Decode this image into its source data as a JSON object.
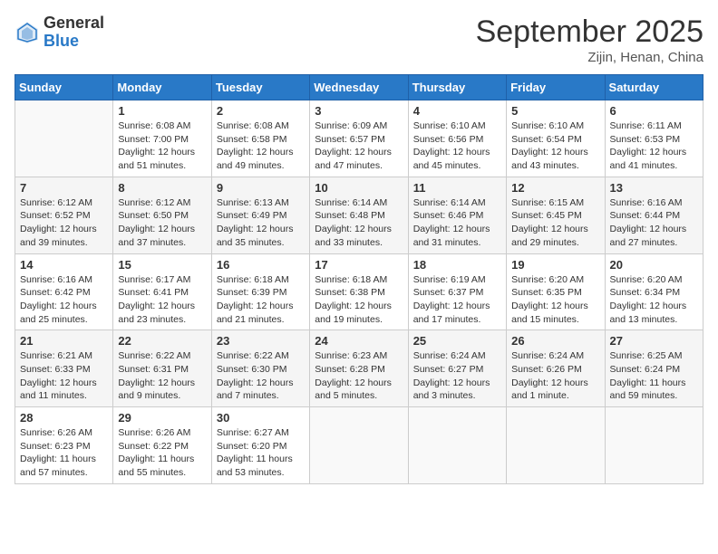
{
  "logo": {
    "general": "General",
    "blue": "Blue"
  },
  "title": "September 2025",
  "subtitle": "Zijin, Henan, China",
  "days_of_week": [
    "Sunday",
    "Monday",
    "Tuesday",
    "Wednesday",
    "Thursday",
    "Friday",
    "Saturday"
  ],
  "weeks": [
    [
      {
        "day": "",
        "info": ""
      },
      {
        "day": "1",
        "info": "Sunrise: 6:08 AM\nSunset: 7:00 PM\nDaylight: 12 hours and 51 minutes."
      },
      {
        "day": "2",
        "info": "Sunrise: 6:08 AM\nSunset: 6:58 PM\nDaylight: 12 hours and 49 minutes."
      },
      {
        "day": "3",
        "info": "Sunrise: 6:09 AM\nSunset: 6:57 PM\nDaylight: 12 hours and 47 minutes."
      },
      {
        "day": "4",
        "info": "Sunrise: 6:10 AM\nSunset: 6:56 PM\nDaylight: 12 hours and 45 minutes."
      },
      {
        "day": "5",
        "info": "Sunrise: 6:10 AM\nSunset: 6:54 PM\nDaylight: 12 hours and 43 minutes."
      },
      {
        "day": "6",
        "info": "Sunrise: 6:11 AM\nSunset: 6:53 PM\nDaylight: 12 hours and 41 minutes."
      }
    ],
    [
      {
        "day": "7",
        "info": "Sunrise: 6:12 AM\nSunset: 6:52 PM\nDaylight: 12 hours and 39 minutes."
      },
      {
        "day": "8",
        "info": "Sunrise: 6:12 AM\nSunset: 6:50 PM\nDaylight: 12 hours and 37 minutes."
      },
      {
        "day": "9",
        "info": "Sunrise: 6:13 AM\nSunset: 6:49 PM\nDaylight: 12 hours and 35 minutes."
      },
      {
        "day": "10",
        "info": "Sunrise: 6:14 AM\nSunset: 6:48 PM\nDaylight: 12 hours and 33 minutes."
      },
      {
        "day": "11",
        "info": "Sunrise: 6:14 AM\nSunset: 6:46 PM\nDaylight: 12 hours and 31 minutes."
      },
      {
        "day": "12",
        "info": "Sunrise: 6:15 AM\nSunset: 6:45 PM\nDaylight: 12 hours and 29 minutes."
      },
      {
        "day": "13",
        "info": "Sunrise: 6:16 AM\nSunset: 6:44 PM\nDaylight: 12 hours and 27 minutes."
      }
    ],
    [
      {
        "day": "14",
        "info": "Sunrise: 6:16 AM\nSunset: 6:42 PM\nDaylight: 12 hours and 25 minutes."
      },
      {
        "day": "15",
        "info": "Sunrise: 6:17 AM\nSunset: 6:41 PM\nDaylight: 12 hours and 23 minutes."
      },
      {
        "day": "16",
        "info": "Sunrise: 6:18 AM\nSunset: 6:39 PM\nDaylight: 12 hours and 21 minutes."
      },
      {
        "day": "17",
        "info": "Sunrise: 6:18 AM\nSunset: 6:38 PM\nDaylight: 12 hours and 19 minutes."
      },
      {
        "day": "18",
        "info": "Sunrise: 6:19 AM\nSunset: 6:37 PM\nDaylight: 12 hours and 17 minutes."
      },
      {
        "day": "19",
        "info": "Sunrise: 6:20 AM\nSunset: 6:35 PM\nDaylight: 12 hours and 15 minutes."
      },
      {
        "day": "20",
        "info": "Sunrise: 6:20 AM\nSunset: 6:34 PM\nDaylight: 12 hours and 13 minutes."
      }
    ],
    [
      {
        "day": "21",
        "info": "Sunrise: 6:21 AM\nSunset: 6:33 PM\nDaylight: 12 hours and 11 minutes."
      },
      {
        "day": "22",
        "info": "Sunrise: 6:22 AM\nSunset: 6:31 PM\nDaylight: 12 hours and 9 minutes."
      },
      {
        "day": "23",
        "info": "Sunrise: 6:22 AM\nSunset: 6:30 PM\nDaylight: 12 hours and 7 minutes."
      },
      {
        "day": "24",
        "info": "Sunrise: 6:23 AM\nSunset: 6:28 PM\nDaylight: 12 hours and 5 minutes."
      },
      {
        "day": "25",
        "info": "Sunrise: 6:24 AM\nSunset: 6:27 PM\nDaylight: 12 hours and 3 minutes."
      },
      {
        "day": "26",
        "info": "Sunrise: 6:24 AM\nSunset: 6:26 PM\nDaylight: 12 hours and 1 minute."
      },
      {
        "day": "27",
        "info": "Sunrise: 6:25 AM\nSunset: 6:24 PM\nDaylight: 11 hours and 59 minutes."
      }
    ],
    [
      {
        "day": "28",
        "info": "Sunrise: 6:26 AM\nSunset: 6:23 PM\nDaylight: 11 hours and 57 minutes."
      },
      {
        "day": "29",
        "info": "Sunrise: 6:26 AM\nSunset: 6:22 PM\nDaylight: 11 hours and 55 minutes."
      },
      {
        "day": "30",
        "info": "Sunrise: 6:27 AM\nSunset: 6:20 PM\nDaylight: 11 hours and 53 minutes."
      },
      {
        "day": "",
        "info": ""
      },
      {
        "day": "",
        "info": ""
      },
      {
        "day": "",
        "info": ""
      },
      {
        "day": "",
        "info": ""
      }
    ]
  ]
}
